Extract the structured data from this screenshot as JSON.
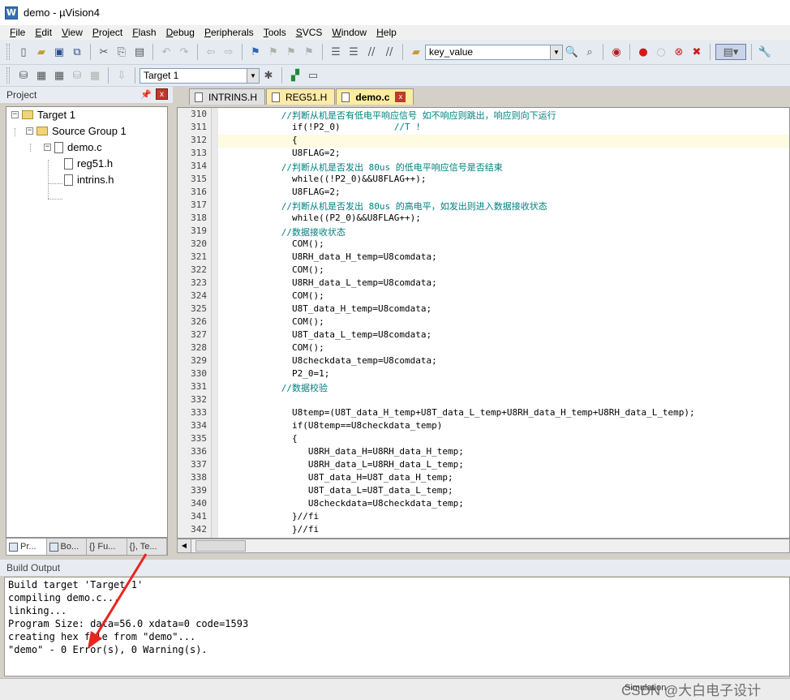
{
  "window": {
    "title": "demo  - µVision4",
    "app_icon": "W"
  },
  "menu": [
    {
      "key": "F",
      "rest": "ile"
    },
    {
      "key": "E",
      "rest": "dit"
    },
    {
      "key": "V",
      "rest": "iew"
    },
    {
      "key": "P",
      "rest": "roject"
    },
    {
      "key": "F",
      "rest": "lash"
    },
    {
      "key": "D",
      "rest": "ebug"
    },
    {
      "key": "P",
      "rest": "eripherals"
    },
    {
      "key": "T",
      "rest": "ools"
    },
    {
      "key": "S",
      "rest": "VCS"
    },
    {
      "key": "W",
      "rest": "indow"
    },
    {
      "key": "H",
      "rest": "elp"
    }
  ],
  "toolbar1": {
    "find_value": "key_value"
  },
  "toolbar2": {
    "target_value": "Target 1"
  },
  "project_panel": {
    "title": "Project",
    "pin_glyph": "📌",
    "close_glyph": "x",
    "tree": {
      "target": "Target 1",
      "group": "Source Group 1",
      "file": "demo.c",
      "includes": [
        "reg51.h",
        "intrins.h"
      ]
    },
    "bottom_tabs": [
      "Pr...",
      "Bo...",
      "{} Fu...",
      "{}, Te..."
    ]
  },
  "editor": {
    "tabs": [
      {
        "label": "INTRINS.H"
      },
      {
        "label": "REG51.H"
      },
      {
        "label": "demo.c"
      }
    ],
    "close_glyph": "x",
    "lines": [
      {
        "n": "310",
        "text": "      //判断从机是否有低电平响应信号 如不响应则跳出，响应则向下运行",
        "comment": true
      },
      {
        "n": "311",
        "text": "        if(!P2_0)          ",
        "tail": "//T !"
      },
      {
        "n": "312",
        "text": "        {"
      },
      {
        "n": "313",
        "text": "        U8FLAG=2;"
      },
      {
        "n": "314",
        "text": "      //判断从机是否发出 80us 的低电平响应信号是否结束",
        "comment": true
      },
      {
        "n": "315",
        "text": "        while((!P2_0)&&U8FLAG++);"
      },
      {
        "n": "316",
        "text": "        U8FLAG=2;"
      },
      {
        "n": "317",
        "text": "      //判断从机是否发出 80us 的高电平，如发出则进入数据接收状态",
        "comment": true
      },
      {
        "n": "318",
        "text": "        while((P2_0)&&U8FLAG++);"
      },
      {
        "n": "319",
        "text": "      //数据接收状态",
        "comment": true
      },
      {
        "n": "320",
        "text": "        COM();"
      },
      {
        "n": "321",
        "text": "        U8RH_data_H_temp=U8comdata;"
      },
      {
        "n": "322",
        "text": "        COM();"
      },
      {
        "n": "323",
        "text": "        U8RH_data_L_temp=U8comdata;"
      },
      {
        "n": "324",
        "text": "        COM();"
      },
      {
        "n": "325",
        "text": "        U8T_data_H_temp=U8comdata;"
      },
      {
        "n": "326",
        "text": "        COM();"
      },
      {
        "n": "327",
        "text": "        U8T_data_L_temp=U8comdata;"
      },
      {
        "n": "328",
        "text": "        COM();"
      },
      {
        "n": "329",
        "text": "        U8checkdata_temp=U8comdata;"
      },
      {
        "n": "330",
        "text": "        P2_0=1;"
      },
      {
        "n": "331",
        "text": "      //数据校验",
        "comment": true
      },
      {
        "n": "332",
        "text": ""
      },
      {
        "n": "333",
        "text": "        U8temp=(U8T_data_H_temp+U8T_data_L_temp+U8RH_data_H_temp+U8RH_data_L_temp);"
      },
      {
        "n": "334",
        "text": "        if(U8temp==U8checkdata_temp)"
      },
      {
        "n": "335",
        "text": "        {"
      },
      {
        "n": "336",
        "text": "           U8RH_data_H=U8RH_data_H_temp;"
      },
      {
        "n": "337",
        "text": "           U8RH_data_L=U8RH_data_L_temp;"
      },
      {
        "n": "338",
        "text": "           U8T_data_H=U8T_data_H_temp;"
      },
      {
        "n": "339",
        "text": "           U8T_data_L=U8T_data_L_temp;"
      },
      {
        "n": "340",
        "text": "           U8checkdata=U8checkdata_temp;"
      },
      {
        "n": "341",
        "text": "        }//fi"
      },
      {
        "n": "342",
        "text": "        }//fi"
      }
    ]
  },
  "build_output": {
    "title": "Build Output",
    "lines": [
      "Build target 'Target 1'",
      "compiling demo.c...",
      "linking...",
      "Program Size: data=56.0 xdata=0 code=1593",
      "creating hex file from \"demo\"...",
      "\"demo\" - 0 Error(s), 0 Warning(s)."
    ]
  },
  "status": {
    "mode": "Simulation",
    "watermark": "CSDN @大白电子设计"
  },
  "colors": {
    "comment": "#008080",
    "annotation_arrow": "#e8251f",
    "close_button": "#c0392b",
    "active_tab": "#ffec9e"
  }
}
